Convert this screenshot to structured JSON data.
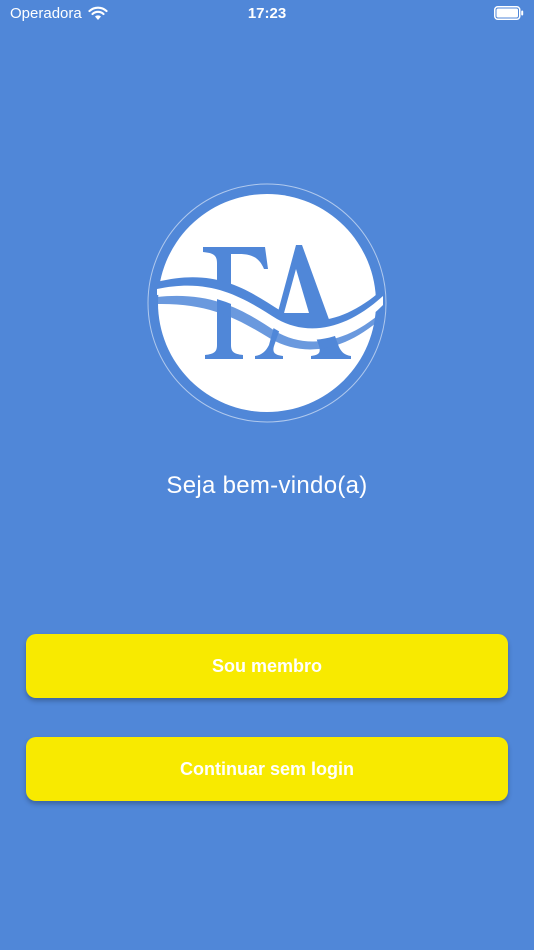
{
  "status_bar": {
    "carrier": "Operadora",
    "time": "17:23"
  },
  "logo": {
    "icon": "fa-logo-icon",
    "text": "FA"
  },
  "welcome_text": "Seja bem-vindo(a)",
  "buttons": {
    "member_label": "Sou membro",
    "guest_label": "Continuar sem login"
  },
  "colors": {
    "background": "#5087d8",
    "button": "#f8ea00",
    "button_text": "#ffffff",
    "logo_circle": "#ffffff"
  }
}
